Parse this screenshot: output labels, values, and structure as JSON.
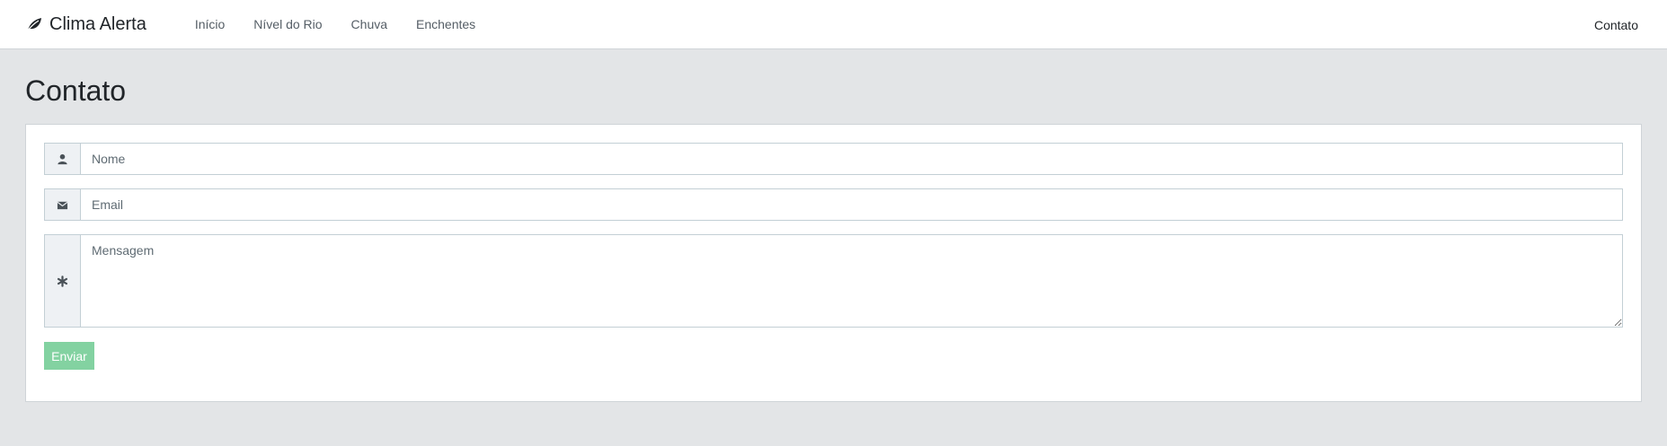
{
  "navbar": {
    "brand": "Clima Alerta",
    "brand_icon": "leaf-icon",
    "links": [
      {
        "label": "Início"
      },
      {
        "label": "Nível do Rio"
      },
      {
        "label": "Chuva"
      },
      {
        "label": "Enchentes"
      }
    ],
    "right_link": "Contato"
  },
  "page": {
    "title": "Contato"
  },
  "form": {
    "name_placeholder": "Nome",
    "name_icon": "user-icon",
    "email_placeholder": "Email",
    "email_icon": "envelope-icon",
    "message_placeholder": "Mensagem",
    "message_icon": "asterisk-icon",
    "submit_label": "Enviar",
    "submit_color": "#83d2a1"
  }
}
